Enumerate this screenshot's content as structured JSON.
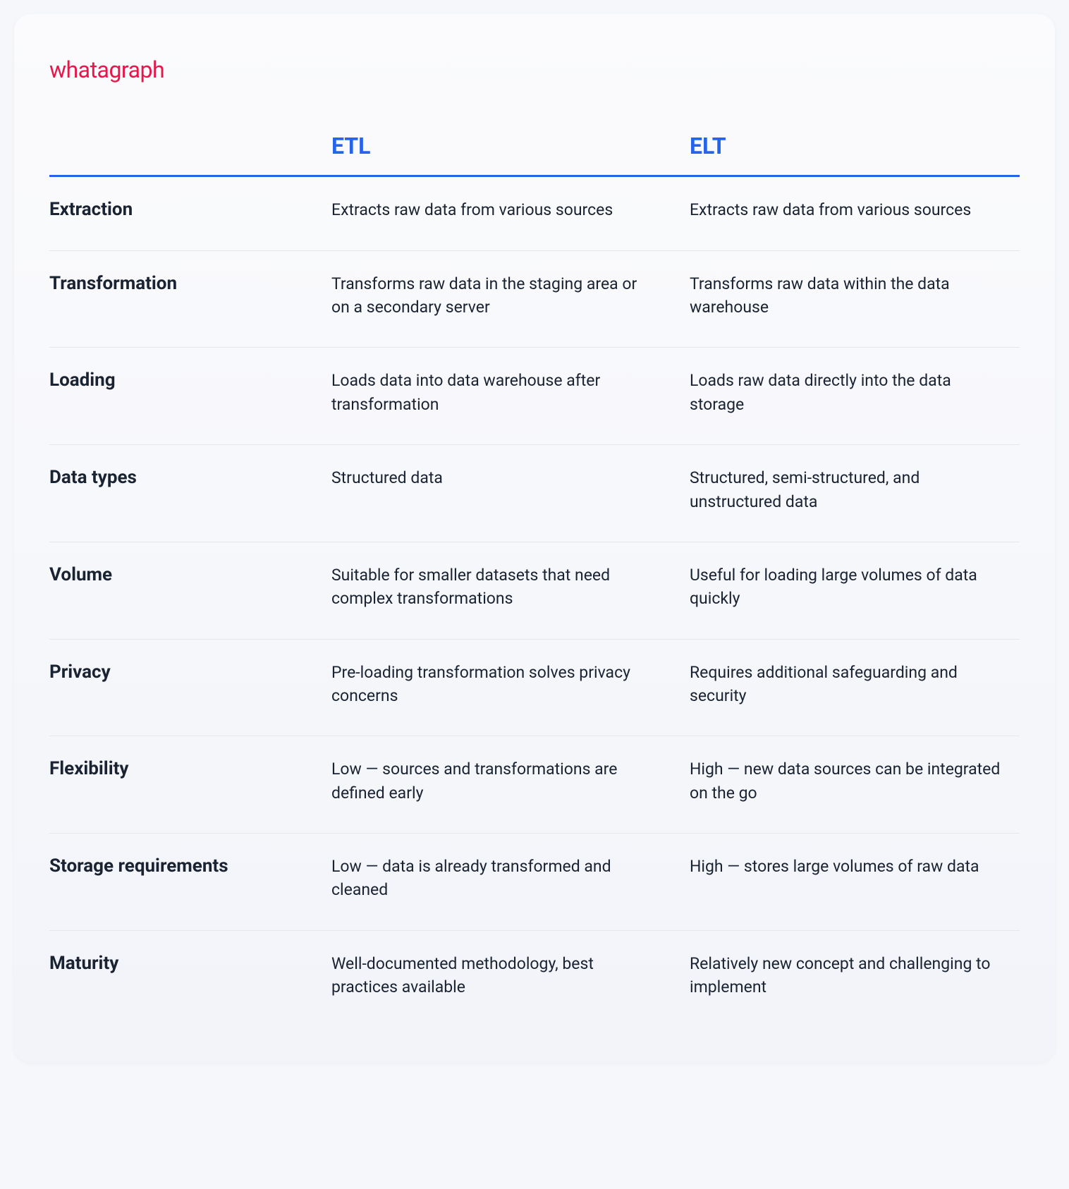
{
  "logo": "whatagraph",
  "columns": {
    "col1": "ETL",
    "col2": "ELT"
  },
  "rows": [
    {
      "label": "Extraction",
      "etl": "Extracts raw data from various sources",
      "elt": "Extracts raw data from various sources"
    },
    {
      "label": "Transformation",
      "etl": "Transforms raw data in the staging area or on a secondary server",
      "elt": "Transforms raw data within the data warehouse"
    },
    {
      "label": "Loading",
      "etl": "Loads data into data warehouse after transformation",
      "elt": "Loads raw data directly into the data storage"
    },
    {
      "label": "Data types",
      "etl": "Structured data",
      "elt": "Structured, semi-structured, and unstructured data"
    },
    {
      "label": "Volume",
      "etl": "Suitable for smaller datasets that need complex transformations",
      "elt": "Useful for loading large volumes of data quickly"
    },
    {
      "label": "Privacy",
      "etl": "Pre-loading transformation solves privacy concerns",
      "elt": "Requires additional safeguarding and security"
    },
    {
      "label": "Flexibility",
      "etl": "Low — sources and transformations are defined early",
      "elt": "High — new data sources can be integrated on the go"
    },
    {
      "label": "Storage requirements",
      "etl": "Low — data is already transformed and cleaned",
      "elt": "High — stores large volumes of raw data"
    },
    {
      "label": "Maturity",
      "etl": "Well-documented methodology, best practices available",
      "elt": "Relatively new concept and challenging to implement"
    }
  ]
}
